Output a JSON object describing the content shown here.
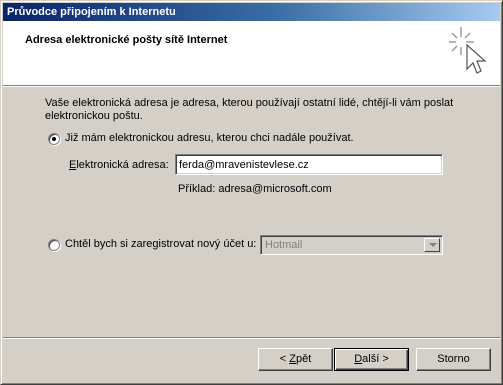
{
  "window": {
    "title": "Průvodce připojením k Internetu"
  },
  "header": {
    "title": "Adresa elektronické pošty sítě Internet",
    "icon": "wizard-sparkle-cursor-icon"
  },
  "intro": {
    "text": "Vaše elektronická adresa je adresa, kterou používají ostatní lidé, chtějí-li vám poslat elektronickou poštu."
  },
  "options": {
    "existing": {
      "label": "Již mám elektronickou adresu, kterou chci nadále používat.",
      "selected": true
    },
    "new_account": {
      "label": "Chtěl bych si zaregistrovat nový účet u:",
      "selected": false
    }
  },
  "email": {
    "label_access_key": "E",
    "label_rest": "lektronická adresa:",
    "value": "ferda@mravenistevlese.cz",
    "example": "Příklad: adresa@microsoft.com"
  },
  "provider": {
    "selected": "Hotmail",
    "enabled": false
  },
  "buttons": {
    "back_prefix": "< ",
    "back_key": "Z",
    "back_rest": "pět",
    "next_key": "D",
    "next_rest": "alší >",
    "cancel": "Storno"
  },
  "colors": {
    "titlebar_start": "#0a246a",
    "titlebar_end": "#a6caf0",
    "face": "#d4d0c8"
  }
}
